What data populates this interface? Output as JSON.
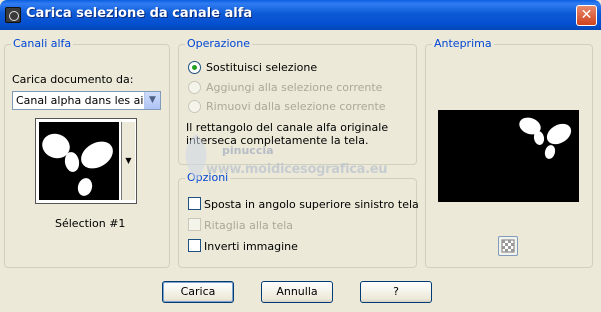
{
  "window": {
    "title": "Carica selezione da canale alfa",
    "close": "✕"
  },
  "canali": {
    "group_title": "Canali alfa",
    "load_from_label": "Carica documento da:",
    "document_value": "Canal alpha dans les ailes",
    "selection_name": "Sélection #1"
  },
  "operazione": {
    "group_title": "Operazione",
    "options": [
      {
        "label": "Sostituisci selezione",
        "checked": true,
        "enabled": true
      },
      {
        "label": "Aggiungi alla selezione corrente",
        "checked": false,
        "enabled": false
      },
      {
        "label": "Rimuovi dalla selezione corrente",
        "checked": false,
        "enabled": false
      }
    ],
    "info_line1": "Il rettangolo del canale alfa originale",
    "info_line2": "interseca completamente la tela."
  },
  "opzioni": {
    "group_title": "Opzioni",
    "checks": [
      {
        "label": "Sposta in angolo superiore sinistro tela",
        "checked": false,
        "enabled": true
      },
      {
        "label": "Ritaglia alla tela",
        "checked": false,
        "enabled": false
      },
      {
        "label": "Inverti immagine",
        "checked": false,
        "enabled": true
      }
    ]
  },
  "anteprima": {
    "group_title": "Anteprima"
  },
  "watermark": {
    "line1": "pinuccia",
    "line2": "www.moidicesografica.eu"
  },
  "buttons": {
    "ok": "Carica",
    "cancel": "Annulla",
    "help": "?"
  }
}
